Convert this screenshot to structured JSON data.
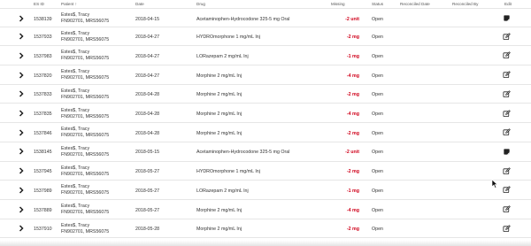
{
  "columns": [
    "ES ID",
    "Patient",
    "Date",
    "Drug",
    "Missing",
    "Status",
    "Reconciled Date",
    "Reconciled By",
    "Edit"
  ],
  "rows": [
    {
      "id": "1538139",
      "patient_name": "Estes$, Tracy",
      "patient_ids": "FN902701, MRS56075",
      "date": "2018-04-15",
      "drug": "Acetaminophen-Hydrocodone 325-5 mg Oral",
      "missing": "-2 unit",
      "status": "Open",
      "edit_icon": "note-icon"
    },
    {
      "id": "1537933",
      "patient_name": "Estes$, Tracy",
      "patient_ids": "FN902701, MRS56075",
      "date": "2018-04-27",
      "drug": "HYDROmorphone 1 mg/mL Inj",
      "missing": "-2 mg",
      "status": "Open",
      "edit_icon": "edit-icon"
    },
    {
      "id": "1537983",
      "patient_name": "Estes$, Tracy",
      "patient_ids": "FN902701, MRS56075",
      "date": "2018-04-27",
      "drug": "LORazepam 2 mg/mL Inj",
      "missing": "-1 mg",
      "status": "Open",
      "edit_icon": "edit-icon"
    },
    {
      "id": "1537820",
      "patient_name": "Estes$, Tracy",
      "patient_ids": "FN902701, MRS56075",
      "date": "2018-04-27",
      "drug": "Morphine 2 mg/mL Inj",
      "missing": "-4 mg",
      "status": "Open",
      "edit_icon": "edit-icon"
    },
    {
      "id": "1537833",
      "patient_name": "Estes$, Tracy",
      "patient_ids": "FN902701, MRS56075",
      "date": "2018-04-28",
      "drug": "Morphine 2 mg/mL Inj",
      "missing": "-2 mg",
      "status": "Open",
      "edit_icon": "edit-icon"
    },
    {
      "id": "1537835",
      "patient_name": "Estes$, Tracy",
      "patient_ids": "FN902701, MRS56075",
      "date": "2018-04-28",
      "drug": "Morphine 2 mg/mL Inj",
      "missing": "-4 mg",
      "status": "Open",
      "edit_icon": "edit-icon"
    },
    {
      "id": "1537846",
      "patient_name": "Estes$, Tracy",
      "patient_ids": "FN902701, MRS56075",
      "date": "2018-04-28",
      "drug": "Morphine 2 mg/mL Inj",
      "missing": "-2 mg",
      "status": "Open",
      "edit_icon": "edit-icon"
    },
    {
      "id": "1538145",
      "patient_name": "Estes$, Tracy",
      "patient_ids": "FN902701, MRS56075",
      "date": "2018-05-15",
      "drug": "Acetaminophen-Hydrocodone 325-5 mg Oral",
      "missing": "-2 unit",
      "status": "Open",
      "edit_icon": "note-icon"
    },
    {
      "id": "1537945",
      "patient_name": "Estes$, Tracy",
      "patient_ids": "FN902701, MRS56075",
      "date": "2018-05-27",
      "drug": "HYDROmorphone 1 mg/mL Inj",
      "missing": "-2 mg",
      "status": "Open",
      "edit_icon": "edit-icon"
    },
    {
      "id": "1537989",
      "patient_name": "Estes$, Tracy",
      "patient_ids": "FN902701, MRS56075",
      "date": "2018-05-27",
      "drug": "LORazepam 2 mg/mL Inj",
      "missing": "-1 mg",
      "status": "Open",
      "edit_icon": "edit-icon"
    },
    {
      "id": "1537889",
      "patient_name": "Estes$, Tracy",
      "patient_ids": "FN902701, MRS56075",
      "date": "2018-05-27",
      "drug": "Morphine 2 mg/mL Inj",
      "missing": "-4 mg",
      "status": "Open",
      "edit_icon": "edit-icon"
    },
    {
      "id": "1537910",
      "patient_name": "Estes$, Tracy",
      "patient_ids": "FN902701, MRS56075",
      "date": "2018-05-28",
      "drug": "Morphine 2 mg/mL Inj",
      "missing": "-2 mg",
      "status": "Open",
      "edit_icon": "edit-icon"
    }
  ],
  "colors": {
    "missing": "#d0021b",
    "border": "#e6e6e6",
    "text": "#333333"
  }
}
